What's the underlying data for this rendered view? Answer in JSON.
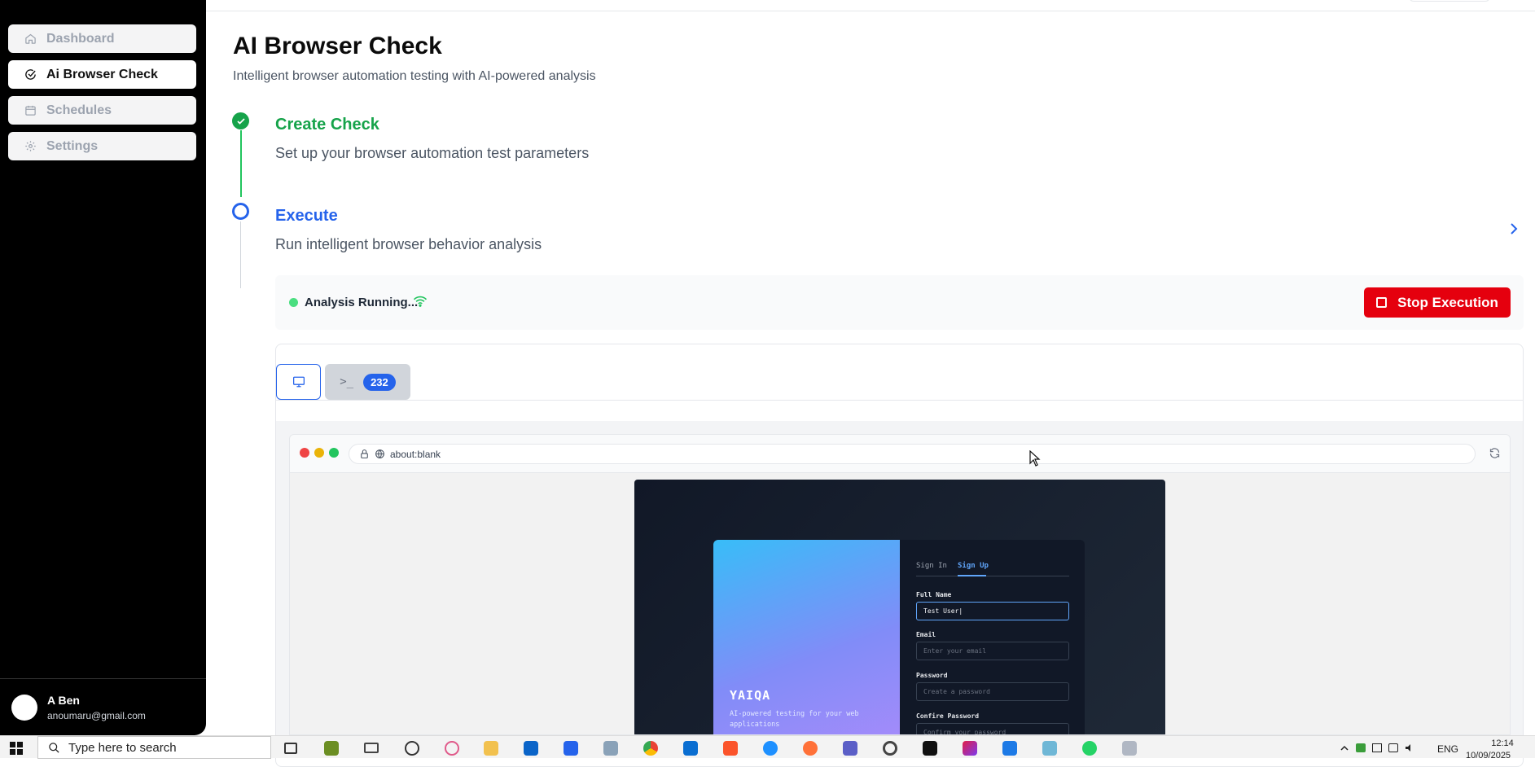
{
  "sidebar": {
    "items": [
      {
        "label": "Dashboard",
        "icon": "home-icon"
      },
      {
        "label": "Ai Browser Check",
        "icon": "check-circle-icon"
      },
      {
        "label": "Schedules",
        "icon": "calendar-icon"
      },
      {
        "label": "Settings",
        "icon": "gear-icon"
      }
    ],
    "user": {
      "name": "A Ben",
      "email": "anoumaru@gmail.com"
    }
  },
  "header": {
    "title": "AI Browser Check",
    "subtitle": "Intelligent browser automation testing with AI-powered analysis"
  },
  "steps": [
    {
      "title": "Create Check",
      "description": "Set up your browser automation test parameters",
      "status": "complete"
    },
    {
      "title": "Execute",
      "description": "Run intelligent browser behavior analysis",
      "status": "active"
    }
  ],
  "status": {
    "text": "Analysis Running...",
    "stop_label": "Stop Execution",
    "colors": {
      "running": "#4ade80",
      "stop": "#e5000e"
    }
  },
  "tabs": {
    "console_prompt": ">_",
    "console_count": "232"
  },
  "browser": {
    "url": "about:blank"
  },
  "preview": {
    "brand": "YAIQA",
    "tagline": "AI-powered testing for your web applications",
    "tab_signin": "Sign In",
    "tab_signup": "Sign Up",
    "fields": [
      {
        "label": "Full Name",
        "value": "Test User|",
        "placeholder": ""
      },
      {
        "label": "Email",
        "value": "",
        "placeholder": "Enter your email"
      },
      {
        "label": "Password",
        "value": "",
        "placeholder": "Create a password"
      },
      {
        "label": "Confire Password",
        "value": "",
        "placeholder": "Confirm your password"
      }
    ]
  },
  "taskbar": {
    "search_placeholder": "Type here to search",
    "lang": "ENG",
    "time": "12:14",
    "date": "10/09/2025"
  },
  "accent": "#2563eb",
  "success": "#16a34a"
}
